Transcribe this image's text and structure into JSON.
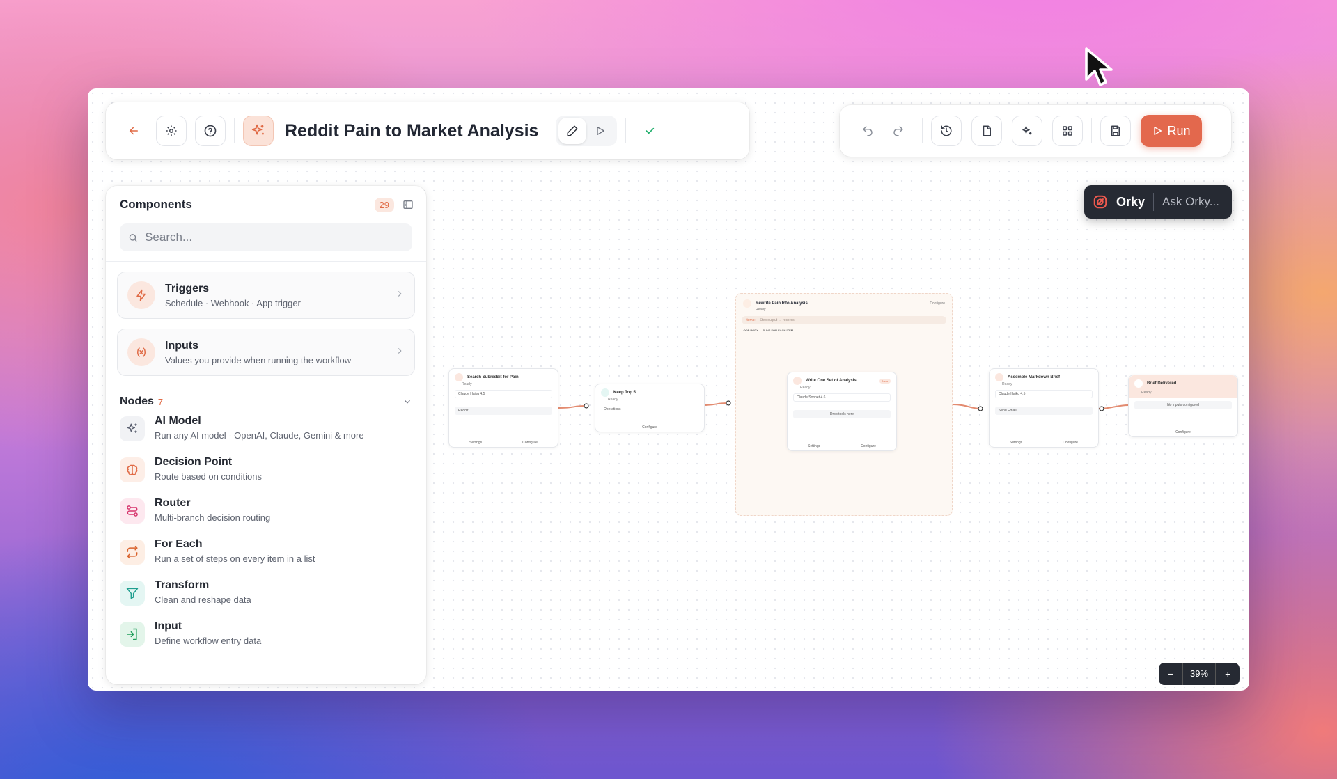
{
  "header": {
    "title": "Reddit Pain to Market Analysis"
  },
  "toolbar": {
    "run_label": "Run"
  },
  "orky": {
    "name": "Orky",
    "ask_placeholder": "Ask Orky..."
  },
  "panel": {
    "title": "Components",
    "count": "29",
    "search_placeholder": "Search...",
    "cards": [
      {
        "title": "Triggers",
        "subtitle": "Schedule · Webhook · App trigger",
        "icon": "lightning-icon"
      },
      {
        "title": "Inputs",
        "subtitle": "Values you provide when running the workflow",
        "icon": "variable-icon"
      }
    ],
    "nodes_title": "Nodes",
    "nodes_count": "7",
    "nodes": [
      {
        "title": "AI Model",
        "subtitle": "Run any AI model - OpenAI, Claude, Gemini & more",
        "icon": "sparkle-icon",
        "color": "#5b6070",
        "bg": "#f1f2f5"
      },
      {
        "title": "Decision Point",
        "subtitle": "Route based on conditions",
        "icon": "brain-icon",
        "color": "#e06a45",
        "bg": "#fdeee7"
      },
      {
        "title": "Router",
        "subtitle": "Multi-branch decision routing",
        "icon": "route-icon",
        "color": "#d6336c",
        "bg": "#fde8ef"
      },
      {
        "title": "For Each",
        "subtitle": "Run a set of steps on every item in a list",
        "icon": "repeat-icon",
        "color": "#d9622b",
        "bg": "#fdeee4"
      },
      {
        "title": "Transform",
        "subtitle": "Clean and reshape data",
        "icon": "filter-icon",
        "color": "#1f9e8f",
        "bg": "#e4f6f3"
      },
      {
        "title": "Input",
        "subtitle": "Define workflow entry data",
        "icon": "login-icon",
        "color": "#1f9e5a",
        "bg": "#e3f5ea"
      }
    ]
  },
  "canvas": {
    "nodes": {
      "search": {
        "title": "Search Subreddit for Pain",
        "status": "Ready",
        "model": "Claude Haiku 4.5",
        "tool": "Reddit",
        "settings": "Settings",
        "configure": "Configure"
      },
      "keep": {
        "title": "Keep Top 5",
        "status": "Ready",
        "row": "Operations",
        "configure": "Configure"
      },
      "loop": {
        "title": "Rewrite Pain Into Analysis",
        "status": "Ready",
        "configure": "Configure",
        "items_label": "Items:",
        "items_value": "Step output → records",
        "body_label": "LOOP BODY — RUNS FOR EACH ITEM"
      },
      "write": {
        "title": "Write One Set of Analysis",
        "status": "Ready",
        "badge": "New",
        "model": "Claude Sonnet 4.6",
        "drop": "Drop tools here",
        "settings": "Settings",
        "configure": "Configure"
      },
      "assemble": {
        "title": "Assemble Markdown Brief",
        "status": "Ready",
        "model": "Claude Haiku 4.5",
        "tool": "Send Email",
        "settings": "Settings",
        "configure": "Configure"
      },
      "brief": {
        "title": "Brief Delivered",
        "status": "Ready",
        "row": "No inputs configured",
        "configure": "Configure"
      }
    }
  },
  "zoom": {
    "minus": "−",
    "level": "39%",
    "plus": "+"
  },
  "colors": {
    "accent": "#e3684d",
    "dark": "#262a33"
  }
}
